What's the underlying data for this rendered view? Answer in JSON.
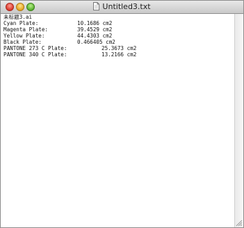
{
  "window": {
    "title": "Untitled3.txt"
  },
  "document": {
    "header": "未标题3.ai",
    "plates": [
      {
        "label": "Cyan Plate:",
        "value": "10.1686 cm2"
      },
      {
        "label": "Magenta Plate:",
        "value": "39.4529 cm2"
      },
      {
        "label": "Yellow Plate:",
        "value": "44.4303 cm2"
      },
      {
        "label": "Black Plate:",
        "value": "0.466405 cm2"
      },
      {
        "label": "PANTONE 273 C Plate:",
        "value": "25.3673 cm2"
      },
      {
        "label": "PANTONE 340 C Plate:",
        "value": "13.2166 cm2"
      }
    ]
  }
}
